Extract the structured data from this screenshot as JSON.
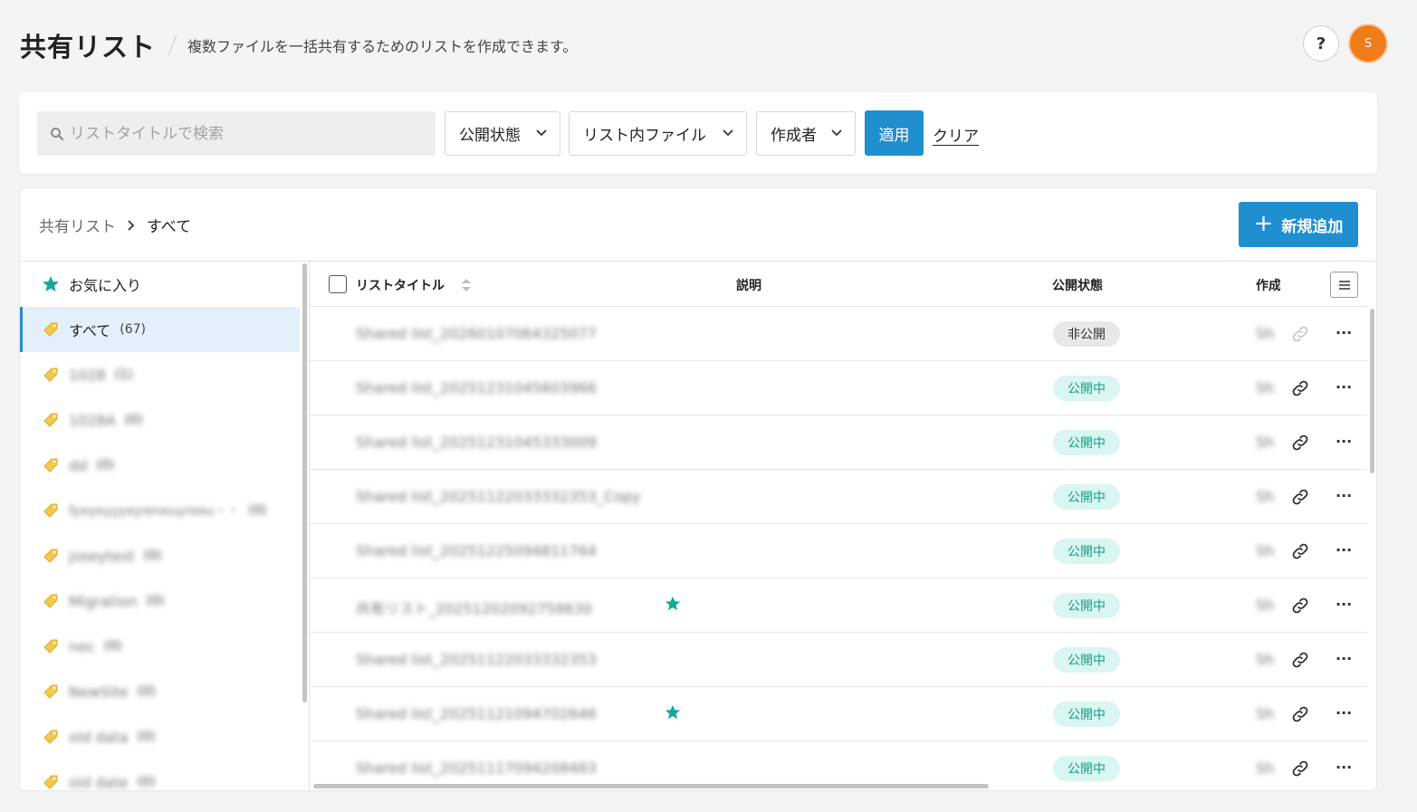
{
  "header": {
    "title": "共有リスト",
    "description": "複数ファイルを一括共有するためのリストを作成できます。",
    "help_label": "?",
    "avatar_initial": "S"
  },
  "filters": {
    "search_placeholder": "リストタイトルで検索",
    "status_label": "公開状態",
    "files_label": "リスト内ファイル",
    "creator_label": "作成者",
    "apply_label": "適用",
    "clear_label": "クリア"
  },
  "breadcrumb": {
    "root": "共有リスト",
    "current": "すべて"
  },
  "add_button_label": "新規追加",
  "sidebar": {
    "items": [
      {
        "label": "お気に入り",
        "icon": "star-icon",
        "count": ""
      },
      {
        "label": "すべて",
        "icon": "tag-icon",
        "count": "(67)"
      },
      {
        "label": "1028",
        "icon": "tag-icon",
        "count": "(1)"
      },
      {
        "label": "1028A",
        "icon": "tag-icon",
        "count": "(0)"
      },
      {
        "label": "dd",
        "icon": "tag-icon",
        "count": "(0)"
      },
      {
        "label": "fyeyeyyyeyreneuyreeu・・",
        "icon": "tag-icon",
        "count": "(0)"
      },
      {
        "label": "joseytest",
        "icon": "tag-icon",
        "count": "(0)"
      },
      {
        "label": "Migration",
        "icon": "tag-icon",
        "count": "(0)"
      },
      {
        "label": "nec",
        "icon": "tag-icon",
        "count": "(0)"
      },
      {
        "label": "NewSite",
        "icon": "tag-icon",
        "count": "(0)"
      },
      {
        "label": "old data",
        "icon": "tag-icon",
        "count": "(0)"
      },
      {
        "label": "old date",
        "icon": "tag-icon",
        "count": "(0)"
      }
    ]
  },
  "table": {
    "columns": {
      "title": "リストタイトル",
      "description": "説明",
      "status": "公開状態",
      "creator": "作成"
    },
    "rows": [
      {
        "title": "Shared list_20260107064325077",
        "starred": false,
        "status": "非公開",
        "public": false,
        "creator": "Sh"
      },
      {
        "title": "Shared list_20251231045603966",
        "starred": false,
        "status": "公開中",
        "public": true,
        "creator": "Sh"
      },
      {
        "title": "Shared list_20251231045333009",
        "starred": false,
        "status": "公開中",
        "public": true,
        "creator": "Sh"
      },
      {
        "title": "Shared list_20251122033332353_Copy",
        "starred": false,
        "status": "公開中",
        "public": true,
        "creator": "Sh"
      },
      {
        "title": "Shared list_20251225094811764",
        "starred": false,
        "status": "公開中",
        "public": true,
        "creator": "Sh"
      },
      {
        "title": "共有リスト_20251202092758630",
        "starred": true,
        "status": "公開中",
        "public": true,
        "creator": "Sh"
      },
      {
        "title": "Shared list_20251122033332353",
        "starred": false,
        "status": "公開中",
        "public": true,
        "creator": "Sh"
      },
      {
        "title": "Shared list_20251121094702646",
        "starred": true,
        "status": "公開中",
        "public": true,
        "creator": "Sh"
      },
      {
        "title": "Shared list_20251117094208483",
        "starred": false,
        "status": "公開中",
        "public": true,
        "creator": "Sh"
      }
    ]
  },
  "colors": {
    "primary": "#1f8fd0",
    "public_badge_bg": "#d9f6f1",
    "public_badge_text": "#109e88",
    "star": "#14a896",
    "tag": "#f2c94c",
    "avatar": "#ef7d1a"
  }
}
